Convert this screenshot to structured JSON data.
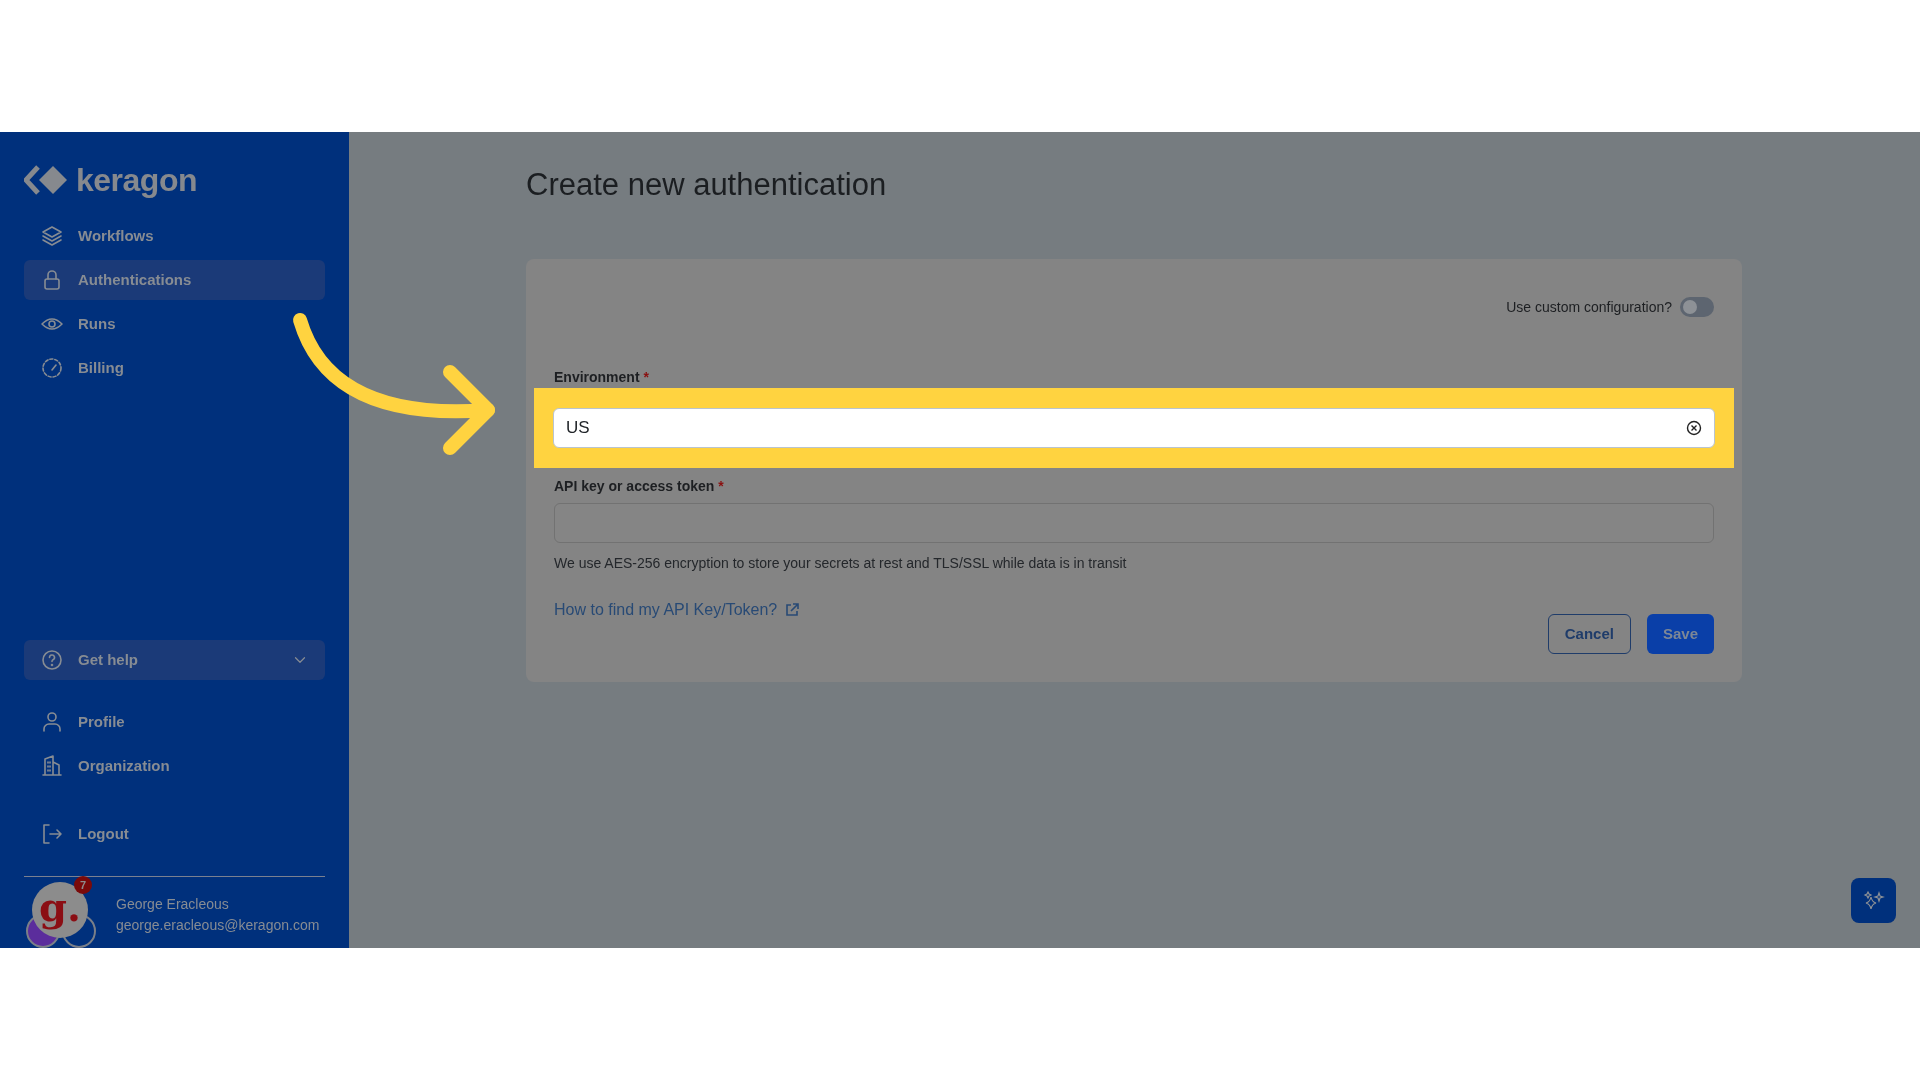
{
  "logo": {
    "text": "keragon"
  },
  "nav": [
    {
      "label": "Workflows",
      "selected": false
    },
    {
      "label": "Authentications",
      "selected": true
    },
    {
      "label": "Runs",
      "selected": false
    },
    {
      "label": "Billing",
      "selected": false
    }
  ],
  "help_menu": {
    "label": "Get help",
    "expanded": false
  },
  "account_nav": [
    {
      "label": "Profile"
    },
    {
      "label": "Organization"
    }
  ],
  "logout": {
    "label": "Logout"
  },
  "user": {
    "name": "George Eracleous",
    "email": "george.eracleous@keragon.com",
    "avatar_text": "g.",
    "notifications": "7"
  },
  "page": {
    "title": "Create new authentication"
  },
  "custom_config": {
    "label": "Use custom configuration?",
    "on": false
  },
  "fields": [
    {
      "label": "Environment",
      "required_mark": "*",
      "value": "US",
      "clearable": true,
      "highlighted": true
    },
    {
      "label": "API key or access token",
      "required_mark": "*",
      "clearable": false,
      "highlighted": false
    }
  ],
  "hint": "We use AES-256 encryption to store your secrets at rest and TLS/SSL while data is in transit",
  "help_link": "How to find my API Key/Token?",
  "buttons": [
    {
      "label": "Cancel",
      "kind": "secondary"
    },
    {
      "label": "Save",
      "kind": "primary"
    }
  ]
}
